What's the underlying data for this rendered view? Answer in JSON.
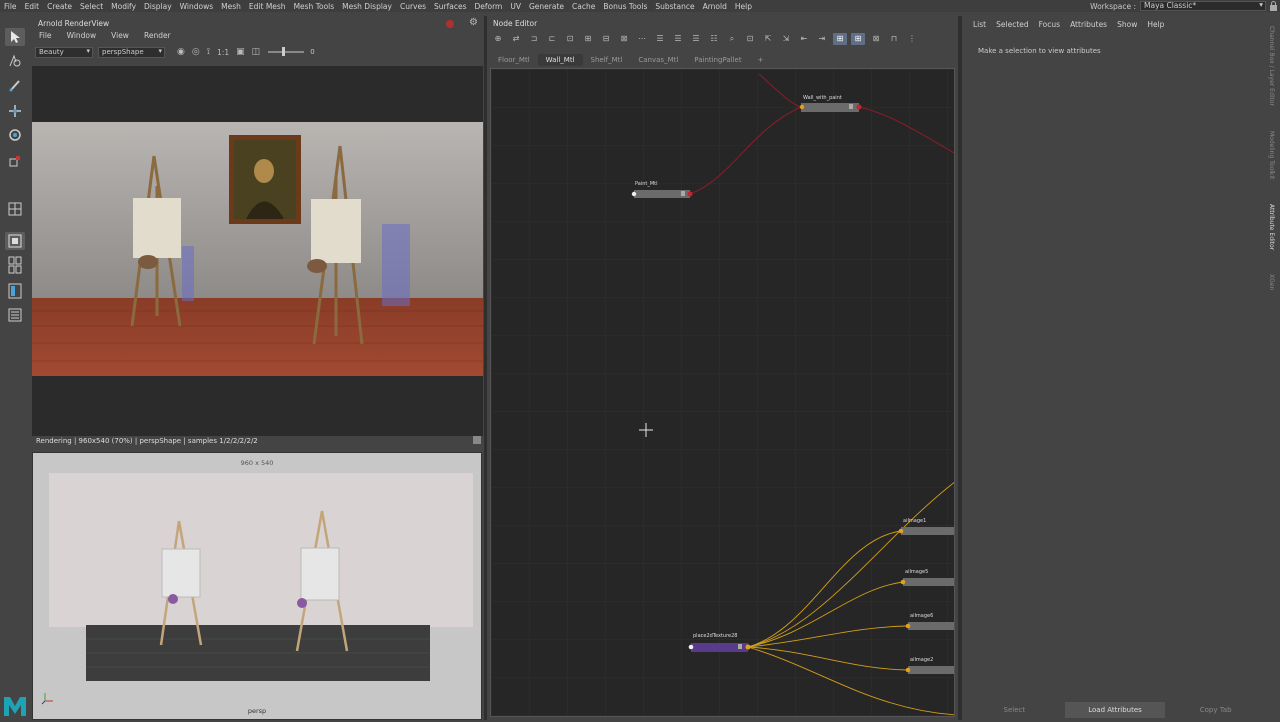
{
  "menubar": {
    "items": [
      "File",
      "Edit",
      "Create",
      "Select",
      "Modify",
      "Display",
      "Windows",
      "Mesh",
      "Edit Mesh",
      "Mesh Tools",
      "Mesh Display",
      "Curves",
      "Surfaces",
      "Deform",
      "UV",
      "Generate",
      "Cache",
      "Bonus Tools",
      "Substance",
      "Arnold",
      "Help"
    ],
    "workspace_label": "Workspace :",
    "workspace_value": "Maya Classic*"
  },
  "render_view": {
    "title": "Arnold RenderView",
    "menu": [
      "File",
      "Window",
      "View",
      "Render"
    ],
    "aov": "Beauty",
    "camera": "perspShape",
    "ratio_label": "1:1",
    "slider_value": "0",
    "status": "Rendering | 960x540 (70%) | perspShape  | samples 1/2/2/2/2/2"
  },
  "viewport": {
    "resolution_label": "960 x 540",
    "camera_label": "persp"
  },
  "node_editor": {
    "title": "Node Editor",
    "tabs": [
      "Floor_Mtl",
      "Wall_Mtl",
      "Shelf_Mtl",
      "Canvas_Mtl",
      "PaintingPallet",
      "+"
    ],
    "active_tab": 1,
    "nodes": {
      "wall_with_paint": "Wall_with_paint",
      "paint_mtl": "Paint_Mtl",
      "place2d": "place2dTexture28",
      "aiimage1": "aiImage1",
      "aiimage5": "aiImage5",
      "aiimage6": "aiImage6",
      "aiimage2": "aiImage2"
    }
  },
  "attribute_editor": {
    "menu": [
      "List",
      "Selected",
      "Focus",
      "Attributes",
      "Show",
      "Help"
    ],
    "message": "Make a selection to view attributes",
    "buttons": [
      "Select",
      "Load Attributes",
      "Copy Tab"
    ]
  },
  "side_tabs": [
    "Channel Box / Layer Editor",
    "Modeling Toolkit",
    "Attribute Editor",
    "XGen"
  ],
  "colors": {
    "red_wire": "#8a1e2a",
    "yellow_wire": "#d4a017",
    "place2d_node": "#5a3a8a"
  }
}
